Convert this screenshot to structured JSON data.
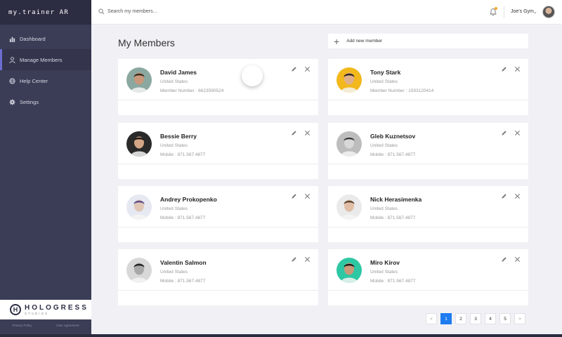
{
  "app": {
    "brand": "my.trainer AR"
  },
  "sidebar": {
    "items": [
      {
        "label": "Dashboard",
        "icon": "bar-chart-icon",
        "active": false
      },
      {
        "label": "Manage Members",
        "icon": "user-icon",
        "active": true
      },
      {
        "label": "Help Center",
        "icon": "globe-icon",
        "active": false
      },
      {
        "label": "Settings",
        "icon": "gear-icon",
        "active": false
      }
    ],
    "logo": {
      "main": "HOLOGRESS",
      "sub": "STUDIOS",
      "mark": "H"
    },
    "legal": {
      "privacy": "Privacy Policy",
      "agreement": "User Agreement"
    }
  },
  "topbar": {
    "search_placeholder": "Search my members...",
    "gym_name": "Joe's Gym",
    "gym_chevron": "⌄"
  },
  "main": {
    "title": "My Members",
    "add_member_label": "Add new member",
    "add_member_plus": "+"
  },
  "members": [
    {
      "name": "David James",
      "country": "United States",
      "meta": "Member Number : 6623590524",
      "avatar_bg": "#8aa8a0",
      "skin": "#c9977a",
      "hair": "#3a2a1e"
    },
    {
      "name": "Tony Stark",
      "country": "United States",
      "meta": "Member Number : 1593120414",
      "avatar_bg": "#f2b81c",
      "skin": "#e0b08c",
      "hair": "#2e2520"
    },
    {
      "name": "Bessie Berry",
      "country": "United States",
      "meta": "Mobile : 871.567.4877",
      "avatar_bg": "#2a2a2a",
      "skin": "#d4a686",
      "hair": "#1c1814"
    },
    {
      "name": "Gleb Kuznetsov",
      "country": "United States",
      "meta": "Mobile : 871.567.4877",
      "avatar_bg": "#bdbdbd",
      "skin": "#d8d8d8",
      "hair": "#3a3a3a"
    },
    {
      "name": "Andrey Prokopenko",
      "country": "United States",
      "meta": "Mobile : 871.567.4877",
      "avatar_bg": "#e6e8f2",
      "skin": "#e0c6b6",
      "hair": "#5a4a8a"
    },
    {
      "name": "Nick Herasimenka",
      "country": "United States",
      "meta": "Mobile : 871.567.4877",
      "avatar_bg": "#eaeaea",
      "skin": "#e1bfa6",
      "hair": "#5a4534"
    },
    {
      "name": "Valentin Salmon",
      "country": "United States",
      "meta": "Mobile : 871.567.4877",
      "avatar_bg": "#d8d8d8",
      "skin": "#a8a8a8",
      "hair": "#222222"
    },
    {
      "name": "Miro Kirov",
      "country": "United States",
      "meta": "Mobile : 871.567.4877",
      "avatar_bg": "#2ec7a4",
      "skin": "#c99a7a",
      "hair": "#1d1a18"
    }
  ],
  "pagination": {
    "prev": "<",
    "pages": [
      "1",
      "2",
      "3",
      "4",
      "5"
    ],
    "current": "1",
    "next": ">"
  },
  "colors": {
    "sidebar": "#3b3c55",
    "accent": "#6b6dd1",
    "pager_active": "#1e7bf0",
    "notification": "#f5a623"
  }
}
